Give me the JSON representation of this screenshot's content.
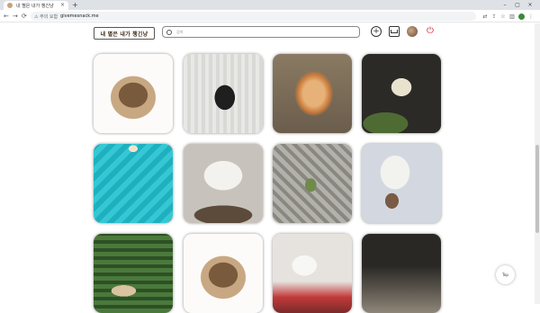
{
  "browser": {
    "tab_title": "내 별은 내가 챙긴냥",
    "tab_close": "×",
    "new_tab": "+",
    "window_controls": [
      "–",
      "▢",
      "×"
    ],
    "nav": {
      "back": "←",
      "forward": "→",
      "reload": "⟳"
    },
    "security_label": "⚠ 주의 요함",
    "url": "givemesnack.me"
  },
  "site": {
    "logo_text": "내 별은 내가 챙긴냥",
    "search_placeholder": "검색",
    "plus_glyph": "+",
    "logout_glyph": "⏻"
  },
  "gallery": {
    "items": [
      {
        "kind": "cat-white",
        "c1": "#fcfbf9",
        "c2": "#c8a882",
        "c3": "#7a5a3c"
      },
      {
        "kind": "cat-bw-crate",
        "c1": "#d9d9d6",
        "c2": "#1f1f1f",
        "c3": "#f5f5f3"
      },
      {
        "kind": "pomeranian",
        "c1": "#8a7a63",
        "c2": "#c97a3a",
        "c3": "#e6b27a"
      },
      {
        "kind": "cat-planter",
        "c1": "#2b2a26",
        "c2": "#e8e2cf",
        "c3": "#4f6b34"
      },
      {
        "kind": "pool",
        "c1": "#1fb0c0",
        "c2": "#35c8d4",
        "c3": "#f0e4cc"
      },
      {
        "kind": "cat-sleeping",
        "c1": "#c7c3bc",
        "c2": "#f4f2ee",
        "c3": "#5c4a3a"
      },
      {
        "kind": "floor-toy",
        "c1": "#b3b1ac",
        "c2": "#8a8780",
        "c3": "#6e8b4a"
      },
      {
        "kind": "dog-white",
        "c1": "#d3d8e0",
        "c2": "#f2f2ef",
        "c3": "#7a5b45"
      },
      {
        "kind": "cat-grass",
        "c1": "#4a7a3a",
        "c2": "#d9c3a0",
        "c3": "#2e4f26"
      },
      {
        "kind": "cat-white",
        "c1": "#fcfbf9",
        "c2": "#c8a882",
        "c3": "#7a5a3c"
      },
      {
        "kind": "dog-sweater",
        "c1": "#e6e3de",
        "c2": "#f7f7f5",
        "c3": "#c23a3a"
      },
      {
        "kind": "dark-room",
        "c1": "#2a2825",
        "c2": "#5a554d",
        "c3": "#8e8678"
      }
    ]
  },
  "top_button_label": "Top"
}
